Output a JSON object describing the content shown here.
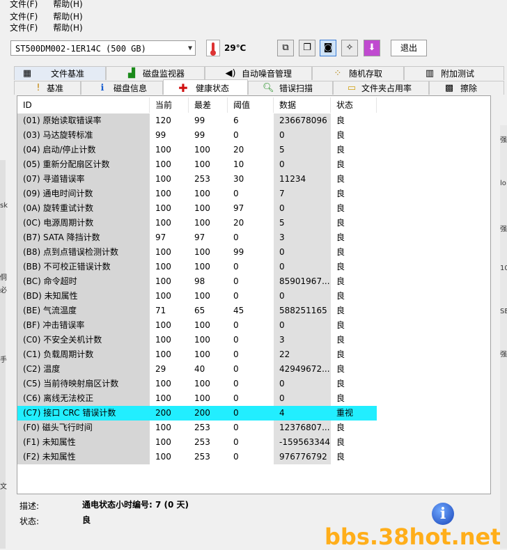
{
  "menu": {
    "row1": [
      "文件(F)",
      "帮助(H)"
    ],
    "row2": [
      "文件(F)",
      "帮助(H)"
    ],
    "row3": [
      "文件(F)",
      "帮助(H)"
    ]
  },
  "toolbar": {
    "drive": "ST500DM002-1ER14C (500 GB)",
    "temperature": "29℃",
    "exit_label": "退出"
  },
  "tabs_top": [
    "文件基准",
    "磁盘监视器",
    "自动噪音管理",
    "随机存取",
    "附加测试"
  ],
  "tabs_bottom": [
    "基准",
    "磁盘信息",
    "健康状态",
    "错误扫描",
    "文件夹占用率",
    "擦除"
  ],
  "table": {
    "headers": [
      "ID",
      "当前",
      "最差",
      "阈值",
      "数据",
      "状态"
    ],
    "rows": [
      [
        "(01) 原始读取错误率",
        "120",
        "99",
        "6",
        "236678096",
        "良"
      ],
      [
        "(03) 马达旋转标准",
        "99",
        "99",
        "0",
        "0",
        "良"
      ],
      [
        "(04) 启动/停止计数",
        "100",
        "100",
        "20",
        "5",
        "良"
      ],
      [
        "(05) 重新分配扇区计数",
        "100",
        "100",
        "10",
        "0",
        "良"
      ],
      [
        "(07) 寻道错误率",
        "100",
        "253",
        "30",
        "11234",
        "良"
      ],
      [
        "(09) 通电时间计数",
        "100",
        "100",
        "0",
        "7",
        "良"
      ],
      [
        "(0A) 旋转重试计数",
        "100",
        "100",
        "97",
        "0",
        "良"
      ],
      [
        "(0C) 电源周期计数",
        "100",
        "100",
        "20",
        "5",
        "良"
      ],
      [
        "(B7) SATA 降挡计数",
        "97",
        "97",
        "0",
        "3",
        "良"
      ],
      [
        "(B8) 点到点错误检测计数",
        "100",
        "100",
        "99",
        "0",
        "良"
      ],
      [
        "(BB) 不可校正错误计数",
        "100",
        "100",
        "0",
        "0",
        "良"
      ],
      [
        "(BC) 命令超时",
        "100",
        "98",
        "0",
        "85901967...",
        "良"
      ],
      [
        "(BD) 未知属性",
        "100",
        "100",
        "0",
        "0",
        "良"
      ],
      [
        "(BE) 气流温度",
        "71",
        "65",
        "45",
        "588251165",
        "良"
      ],
      [
        "(BF) 冲击错误率",
        "100",
        "100",
        "0",
        "0",
        "良"
      ],
      [
        "(C0) 不安全关机计数",
        "100",
        "100",
        "0",
        "3",
        "良"
      ],
      [
        "(C1) 负载周期计数",
        "100",
        "100",
        "0",
        "22",
        "良"
      ],
      [
        "(C2) 温度",
        "29",
        "40",
        "0",
        "42949672...",
        "良"
      ],
      [
        "(C5) 当前待映射扇区计数",
        "100",
        "100",
        "0",
        "0",
        "良"
      ],
      [
        "(C6) 离线无法校正",
        "100",
        "100",
        "0",
        "0",
        "良"
      ],
      [
        "(C7) 接口 CRC 错误计数",
        "200",
        "200",
        "0",
        "4",
        "重视"
      ],
      [
        "(F0) 磁头飞行时间",
        "100",
        "253",
        "0",
        "12376807...",
        "良"
      ],
      [
        "(F1) 未知属性",
        "100",
        "253",
        "0",
        "-159563344",
        "良"
      ],
      [
        "(F2) 未知属性",
        "100",
        "253",
        "0",
        "976776792",
        "良"
      ]
    ],
    "highlight_row": 20,
    "highlight_color": "#22eeff"
  },
  "footer": {
    "desc_label": "描述:",
    "desc_value": "通电状态小时编号: 7 (0 天)",
    "state_label": "状态:",
    "state_value": "良"
  },
  "watermark": "bbs.38hot.net",
  "side_strip_right": [
    "强",
    "lo",
    "强",
    "10",
    "SE",
    "强"
  ],
  "side_strip_left": [
    "sk",
    "",
    "侗",
    "必",
    "",
    "手",
    "文"
  ]
}
